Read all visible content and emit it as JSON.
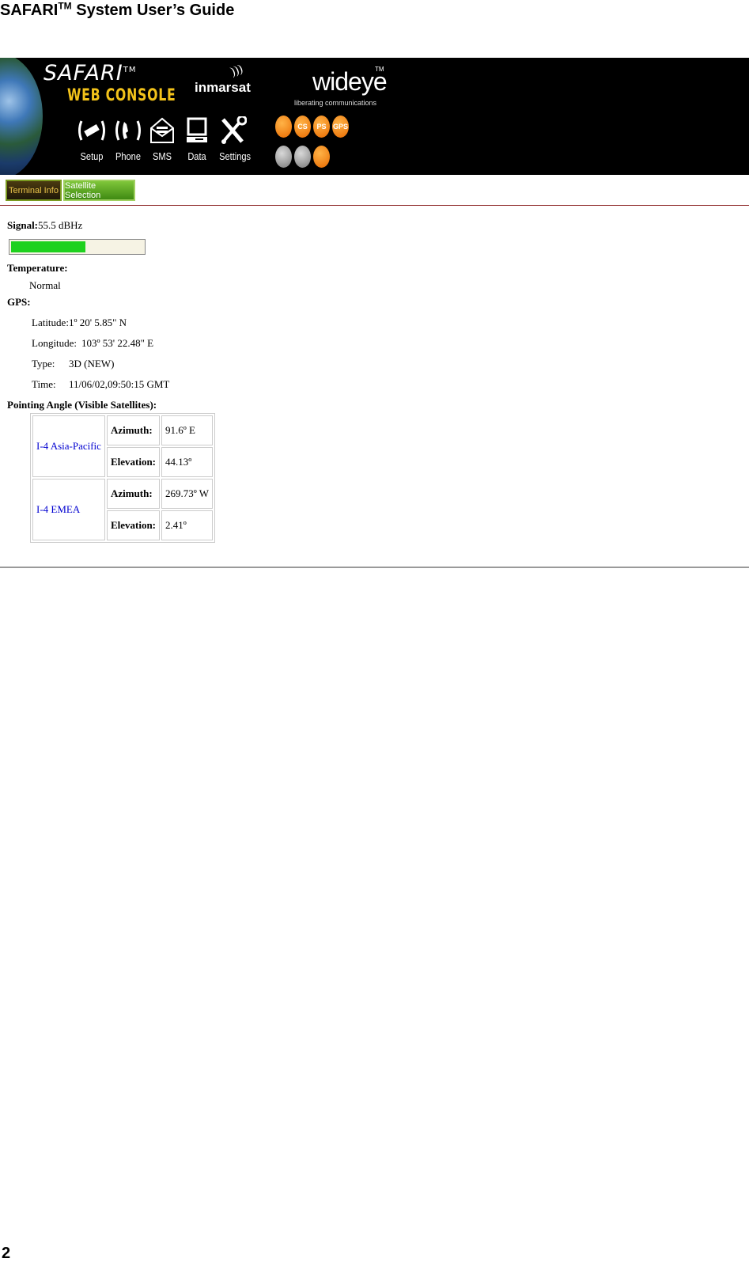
{
  "document": {
    "title": "SAFARI",
    "title_sup": "TM",
    "title_rest": " System User’s Guide",
    "page_number": "2"
  },
  "banner": {
    "safari": "SAFARI",
    "safari_tm": "TM",
    "web_console": "WEB CONSOLE",
    "inmarsat": "inmarsat",
    "wideye": "wideye",
    "wideye_tm": "TM",
    "wideye_tagline": "liberating communications",
    "nav": [
      {
        "label": "Setup",
        "icon": "setup-icon"
      },
      {
        "label": "Phone",
        "icon": "phone-icon"
      },
      {
        "label": "SMS",
        "icon": "sms-icon"
      },
      {
        "label": "Data",
        "icon": "data-icon"
      },
      {
        "label": "Settings",
        "icon": "settings-icon"
      }
    ],
    "status_icons": [
      {
        "text": "",
        "color": "#f08a1a"
      },
      {
        "text": "CS",
        "color": "#f08a1a"
      },
      {
        "text": "PS",
        "color": "#f08a1a"
      },
      {
        "text": "GPS",
        "color": "#f08a1a"
      },
      {
        "text": "",
        "color": "#9a9a9a"
      },
      {
        "text": "",
        "color": "#9a9a9a"
      },
      {
        "text": "",
        "color": "#f08a1a"
      }
    ]
  },
  "tabs": {
    "terminal_info": "Terminal Info",
    "satellite_selection": "Satellite Selection"
  },
  "info": {
    "signal_label": "Signal:",
    "signal_value": "55.5 dBHz",
    "signal_level": 0.56,
    "temperature_label": "Temperature:",
    "temperature_value": "Normal",
    "gps_label": "GPS:",
    "latitude_label": "Latitude:",
    "latitude_value": "1º 20' 5.85\" N",
    "longitude_label": "Longitude:",
    "longitude_value": "103º 53' 22.48\" E",
    "type_label": "Type:",
    "type_value": "3D (NEW)",
    "time_label": "Time:",
    "time_value": "11/06/02,09:50:15 GMT",
    "pointing_label": "Pointing Angle (Visible Satellites):"
  },
  "satellites": [
    {
      "name": "I-4 Asia-Pacific",
      "azimuth_label": "Azimuth:",
      "azimuth": "91.6º E",
      "elevation_label": "Elevation:",
      "elevation": "44.13º"
    },
    {
      "name": "I-4 EMEA",
      "azimuth_label": "Azimuth:",
      "azimuth": "269.73º W",
      "elevation_label": "Elevation:",
      "elevation": "2.41º"
    }
  ]
}
